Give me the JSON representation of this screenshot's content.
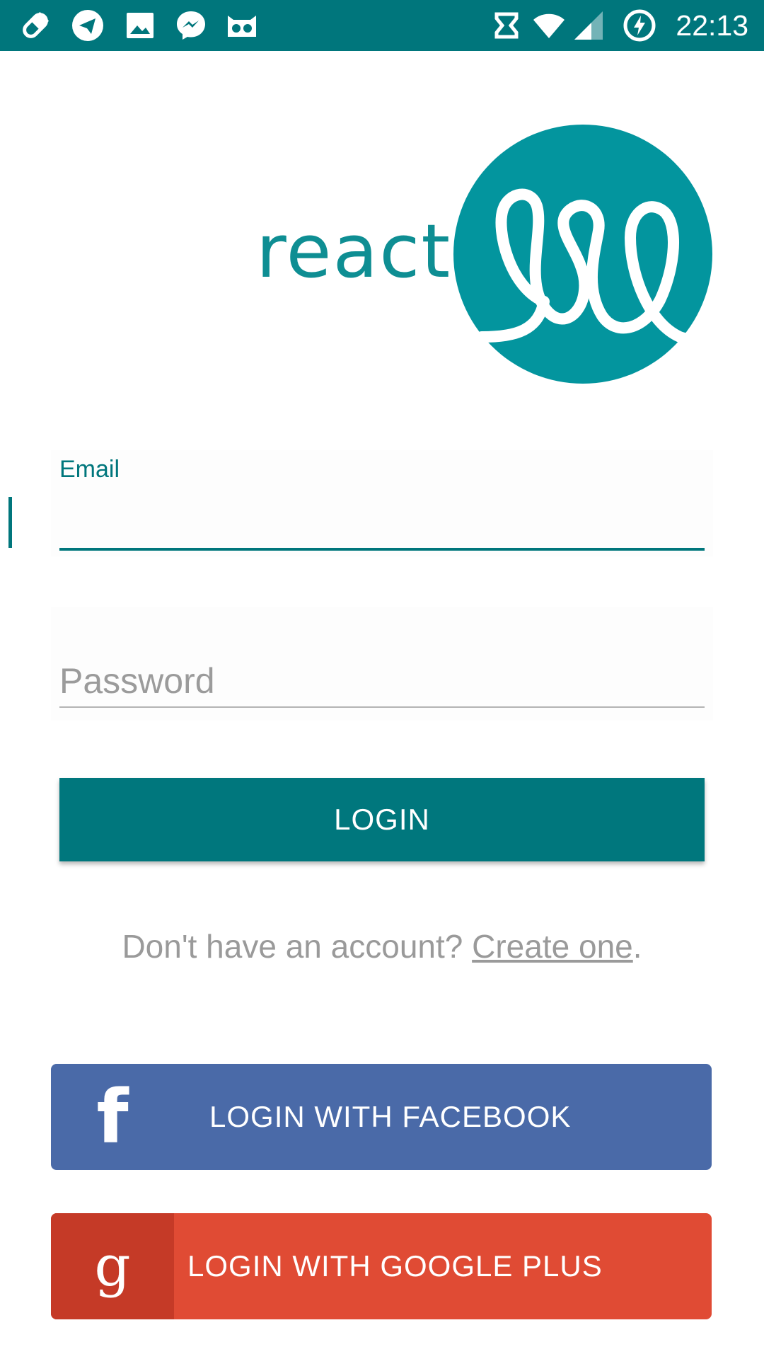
{
  "status_bar": {
    "time": "22:13",
    "left_icons": [
      "pill-icon",
      "telegram-icon",
      "image-icon",
      "messenger-icon",
      "robot-icon"
    ],
    "right_icons": [
      "nfc-icon",
      "wifi-icon",
      "signal-icon",
      "battery-charging-icon"
    ]
  },
  "logo": {
    "wordmark": "react"
  },
  "form": {
    "email_label": "Email",
    "email_value": "",
    "password_placeholder": "Password",
    "login_button": "LOGIN"
  },
  "signup": {
    "prompt": "Don't have an account? ",
    "link": "Create one",
    "suffix": "."
  },
  "social": {
    "facebook_label": "LOGIN WITH FACEBOOK",
    "google_label": "LOGIN WITH GOOGLE PLUS",
    "facebook_icon_glyph": "f",
    "google_icon_glyph": "g"
  },
  "colors": {
    "primary": "#00767C",
    "logo": "#0E8E93",
    "facebook": "#4A6AA8",
    "google": "#E04B34",
    "google_dark": "#C53A27"
  }
}
